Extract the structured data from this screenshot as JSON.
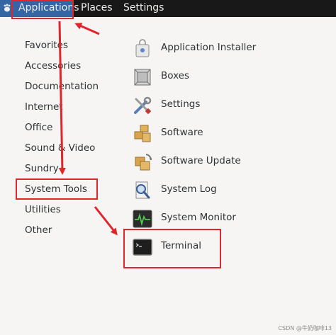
{
  "topbar": {
    "applications": "Applications",
    "places": "Places",
    "settings": "Settings"
  },
  "categories": [
    {
      "label": "Favorites"
    },
    {
      "label": "Accessories"
    },
    {
      "label": "Documentation"
    },
    {
      "label": "Internet"
    },
    {
      "label": "Office"
    },
    {
      "label": "Sound & Video"
    },
    {
      "label": "Sundry"
    },
    {
      "label": "System Tools"
    },
    {
      "label": "Utilities"
    },
    {
      "label": "Other"
    }
  ],
  "apps": [
    {
      "label": "Application Installer",
      "icon": "package-installer-icon"
    },
    {
      "label": "Boxes",
      "icon": "boxes-icon"
    },
    {
      "label": "Settings",
      "icon": "settings-tools-icon"
    },
    {
      "label": "Software",
      "icon": "software-boxes-icon"
    },
    {
      "label": "Software Update",
      "icon": "software-update-icon"
    },
    {
      "label": "System Log",
      "icon": "system-log-icon"
    },
    {
      "label": "System Monitor",
      "icon": "system-monitor-icon"
    },
    {
      "label": "Terminal",
      "icon": "terminal-icon"
    }
  ],
  "watermark": "CSDN @牛奶咖啡13",
  "colors": {
    "topbar": "#181818",
    "active": "#3465a4",
    "menu_bg": "#f6f5f4",
    "annotation": "#e0262b"
  }
}
